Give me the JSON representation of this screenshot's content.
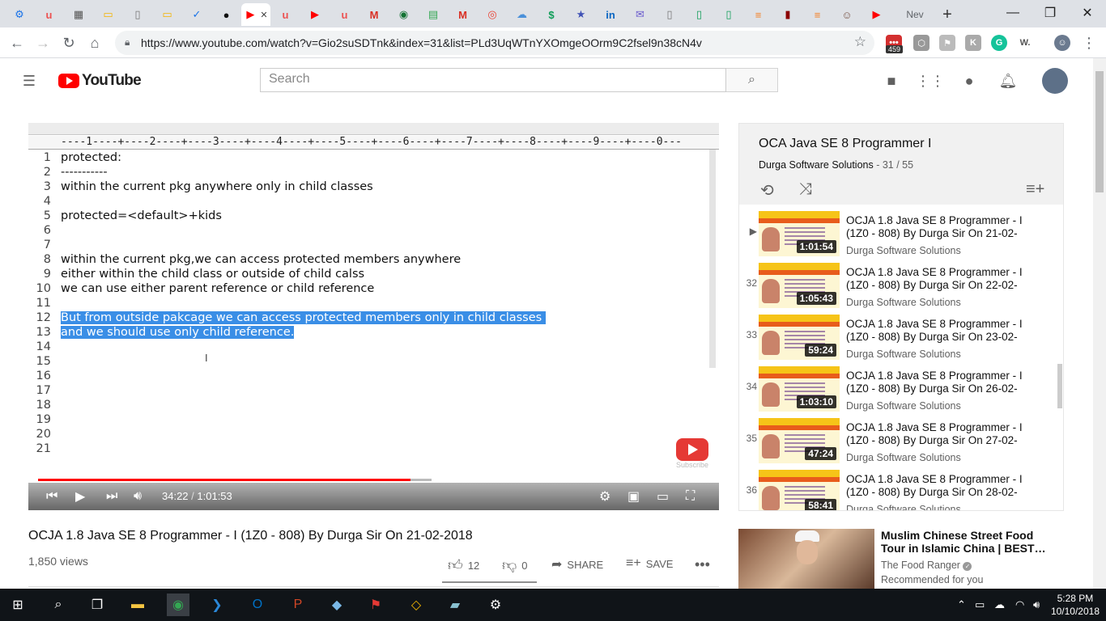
{
  "browser": {
    "url": "https://www.youtube.com/watch?v=Gio2suSDTnk&index=31&list=PLd3UqWTnYXOmgeOOrm9C2fsel9n38cN4v",
    "new_tab_label": "Nev",
    "tabs": [
      {
        "icon": "gear-icon",
        "glyph": "⚙",
        "color": "#1a73e8"
      },
      {
        "icon": "udemy-icon",
        "glyph": "u",
        "color": "#ec5252"
      },
      {
        "icon": "calendar-icon",
        "glyph": "▦",
        "color": "#555555"
      },
      {
        "icon": "slides-icon",
        "glyph": "▭",
        "color": "#f4b400"
      },
      {
        "icon": "document-icon",
        "glyph": "▯",
        "color": "#777777"
      },
      {
        "icon": "slides-icon",
        "glyph": "▭",
        "color": "#f4b400"
      },
      {
        "icon": "shield-icon",
        "glyph": "✓",
        "color": "#1a73e8"
      },
      {
        "icon": "github-icon",
        "glyph": "●",
        "color": "#111111"
      },
      {
        "icon": "youtube-icon",
        "glyph": "▶",
        "color": "#ff0000"
      },
      {
        "icon": "udemy-icon",
        "glyph": "u",
        "color": "#ec5252"
      },
      {
        "icon": "youtube-icon",
        "glyph": "▶",
        "color": "#ff0000"
      },
      {
        "icon": "udemy-icon",
        "glyph": "u",
        "color": "#ec5252"
      },
      {
        "icon": "gmail-icon",
        "glyph": "M",
        "color": "#d93025"
      },
      {
        "icon": "globe-icon",
        "glyph": "◉",
        "color": "#137333"
      },
      {
        "icon": "map-icon",
        "glyph": "▤",
        "color": "#34a853"
      },
      {
        "icon": "gmail-icon",
        "glyph": "M",
        "color": "#d93025"
      },
      {
        "icon": "circle-icon",
        "glyph": "◎",
        "color": "#ea4335"
      },
      {
        "icon": "cloud-icon",
        "glyph": "☁",
        "color": "#4a90d9"
      },
      {
        "icon": "dollar-icon",
        "glyph": "$",
        "color": "#0f9d58"
      },
      {
        "icon": "star-icon",
        "glyph": "★",
        "color": "#3f51b5"
      },
      {
        "icon": "linkedin-icon",
        "glyph": "in",
        "color": "#0a66c2"
      },
      {
        "icon": "mail-icon",
        "glyph": "✉",
        "color": "#6a5acd"
      },
      {
        "icon": "document-icon",
        "glyph": "▯",
        "color": "#777777"
      },
      {
        "icon": "sheet-icon",
        "glyph": "▯",
        "color": "#0f9d58"
      },
      {
        "icon": "sheet-icon",
        "glyph": "▯",
        "color": "#0f9d58"
      },
      {
        "icon": "stack-icon",
        "glyph": "≡",
        "color": "#f48024"
      },
      {
        "icon": "book-icon",
        "glyph": "▮",
        "color": "#8b0000"
      },
      {
        "icon": "stack-icon",
        "glyph": "≡",
        "color": "#f48024"
      },
      {
        "icon": "robot-icon",
        "glyph": "☺",
        "color": "#795548"
      },
      {
        "icon": "youtube-icon",
        "glyph": "▶",
        "color": "#ff0000"
      }
    ],
    "extensions": [
      {
        "icon": "lastpass-icon",
        "badge": "459"
      }
    ]
  },
  "youtube": {
    "logo_text": "YouTube",
    "search_placeholder": "Search"
  },
  "editor": {
    "ruler": "----1----+----2----+----3----+----4----+----5----+----6----+----7----+----8----+----9----+----0---",
    "lines": [
      {
        "n": "1",
        "text": "protected:",
        "sel": false
      },
      {
        "n": "2",
        "text": "-----------",
        "sel": false
      },
      {
        "n": "3",
        "text": "within the current pkg anywhere only in child classes",
        "sel": false
      },
      {
        "n": "4",
        "text": "",
        "sel": false
      },
      {
        "n": "5",
        "text": "protected=<default>+kids",
        "sel": false
      },
      {
        "n": "6",
        "text": "",
        "sel": false
      },
      {
        "n": "7",
        "text": "",
        "sel": false
      },
      {
        "n": "8",
        "text": "within the current pkg,we can access protected members anywhere",
        "sel": false
      },
      {
        "n": "9",
        "text": "either within the child class or outside of child calss",
        "sel": false
      },
      {
        "n": "10",
        "text": "we can use either parent reference or child reference",
        "sel": false
      },
      {
        "n": "11",
        "text": "",
        "sel": false
      },
      {
        "n": "12",
        "text": "But from outside pakcage we can access protected members only in child classes ",
        "sel": true
      },
      {
        "n": "13",
        "text": "and we should use only child reference.",
        "sel": true
      },
      {
        "n": "14",
        "text": "",
        "sel": false
      },
      {
        "n": "15",
        "text": "",
        "sel": false
      },
      {
        "n": "16",
        "text": "",
        "sel": false
      },
      {
        "n": "17",
        "text": "",
        "sel": false
      },
      {
        "n": "18",
        "text": "",
        "sel": false
      },
      {
        "n": "19",
        "text": "",
        "sel": false
      },
      {
        "n": "20",
        "text": "",
        "sel": false
      },
      {
        "n": "21",
        "text": "",
        "sel": false
      }
    ],
    "watermark": "Subscribe"
  },
  "player": {
    "current_time": "34:22",
    "duration": "1:01:53",
    "played_fraction": 0.555,
    "buffered_fraction": 0.587
  },
  "video": {
    "title": "OCJA 1.8 Java SE 8 Programmer - I (1Z0 - 808) By Durga Sir On 21-02-2018",
    "views": "1,850 views",
    "likes": "12",
    "dislikes": "0",
    "share_label": "SHARE",
    "save_label": "SAVE"
  },
  "playlist": {
    "title": "OCA Java SE 8 Programmer I",
    "channel": "Durga Software Solutions",
    "position": "31 / 55",
    "items": [
      {
        "index": "▶",
        "title": "OCJA 1.8 Java SE 8 Programmer - I (1Z0 - 808) By Durga Sir On 21-02-",
        "channel": "Durga Software Solutions",
        "duration": "1:01:54"
      },
      {
        "index": "32",
        "title": "OCJA 1.8 Java SE 8 Programmer - I (1Z0 - 808) By Durga Sir On 22-02-",
        "channel": "Durga Software Solutions",
        "duration": "1:05:43"
      },
      {
        "index": "33",
        "title": "OCJA 1.8 Java SE 8 Programmer - I (1Z0 - 808) By Durga Sir On 23-02-",
        "channel": "Durga Software Solutions",
        "duration": "59:24"
      },
      {
        "index": "34",
        "title": "OCJA 1.8 Java SE 8 Programmer - I (1Z0 - 808) By Durga Sir On 26-02-",
        "channel": "Durga Software Solutions",
        "duration": "1:03:10"
      },
      {
        "index": "35",
        "title": "OCJA 1.8 Java SE 8 Programmer - I (1Z0 - 808) By Durga Sir On 27-02-",
        "channel": "Durga Software Solutions",
        "duration": "47:24"
      },
      {
        "index": "36",
        "title": "OCJA 1.8 Java SE 8 Programmer - I (1Z0 - 808) By Durga Sir On 28-02-",
        "channel": "Durga Software Solutions",
        "duration": "58:41"
      }
    ]
  },
  "recommended": {
    "title": "Muslim Chinese Street Food Tour in Islamic China | BEST…",
    "channel": "The Food Ranger",
    "label": "Recommended for you"
  },
  "taskbar": {
    "time": "5:28 PM",
    "date": "10/10/2018",
    "apps": [
      {
        "icon": "search-icon",
        "glyph": "⌕",
        "color": "#ffffff"
      },
      {
        "icon": "task-view-icon",
        "glyph": "❐",
        "color": "#ffffff"
      },
      {
        "icon": "file-explorer-icon",
        "glyph": "▬",
        "color": "#f4c542"
      },
      {
        "icon": "chrome-icon",
        "glyph": "◉",
        "color": "#34a853"
      },
      {
        "icon": "vscode-icon",
        "glyph": "❯",
        "color": "#2b88d8"
      },
      {
        "icon": "outlook-icon",
        "glyph": "O",
        "color": "#0072c6"
      },
      {
        "icon": "powerpoint-icon",
        "glyph": "P",
        "color": "#d24726"
      },
      {
        "icon": "box-icon",
        "glyph": "◆",
        "color": "#7ab8e6"
      },
      {
        "icon": "pdf-icon",
        "glyph": "⚑",
        "color": "#e53935"
      },
      {
        "icon": "git-icon",
        "glyph": "◇",
        "color": "#f0b400"
      },
      {
        "icon": "notes-icon",
        "glyph": "▰",
        "color": "#88c0d0"
      },
      {
        "icon": "settings-icon",
        "glyph": "⚙",
        "color": "#ffffff"
      }
    ]
  }
}
